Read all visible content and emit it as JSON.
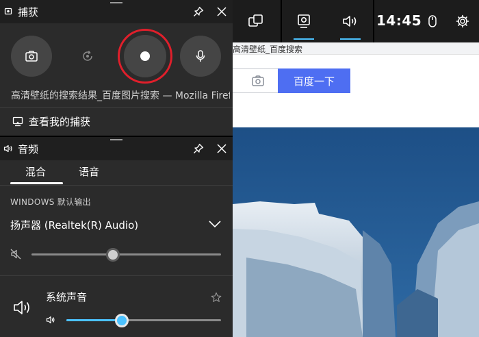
{
  "browser": {
    "tab_title": "高清壁纸_百度搜索",
    "search_button": "百度一下"
  },
  "topbar": {
    "clock": "14:45",
    "icons": [
      "widget-menu-icon",
      "capture-widget-icon",
      "audio-widget-icon",
      "mouse-icon",
      "settings-gear-icon"
    ],
    "accent_color": "#4cc2ff"
  },
  "capture": {
    "title": "捕获",
    "buttons": [
      "screenshot-camera-icon",
      "record-last-icon",
      "record-start-icon",
      "microphone-icon"
    ],
    "record_ring_color": "#e01f2b",
    "window_title": "高清壁纸的搜索结果_百度图片搜索 — Mozilla Firefox",
    "view_captures": "查看我的捕获"
  },
  "audio": {
    "title": "音频",
    "tabs": [
      {
        "label": "混合",
        "selected": true
      },
      {
        "label": "语音",
        "selected": false
      }
    ],
    "output_section": "WINDOWS 默认输出",
    "device": "扬声器 (Realtek(R) Audio)",
    "device_volume": 0.43,
    "app": {
      "name": "系统声音",
      "volume": 0.36
    }
  }
}
